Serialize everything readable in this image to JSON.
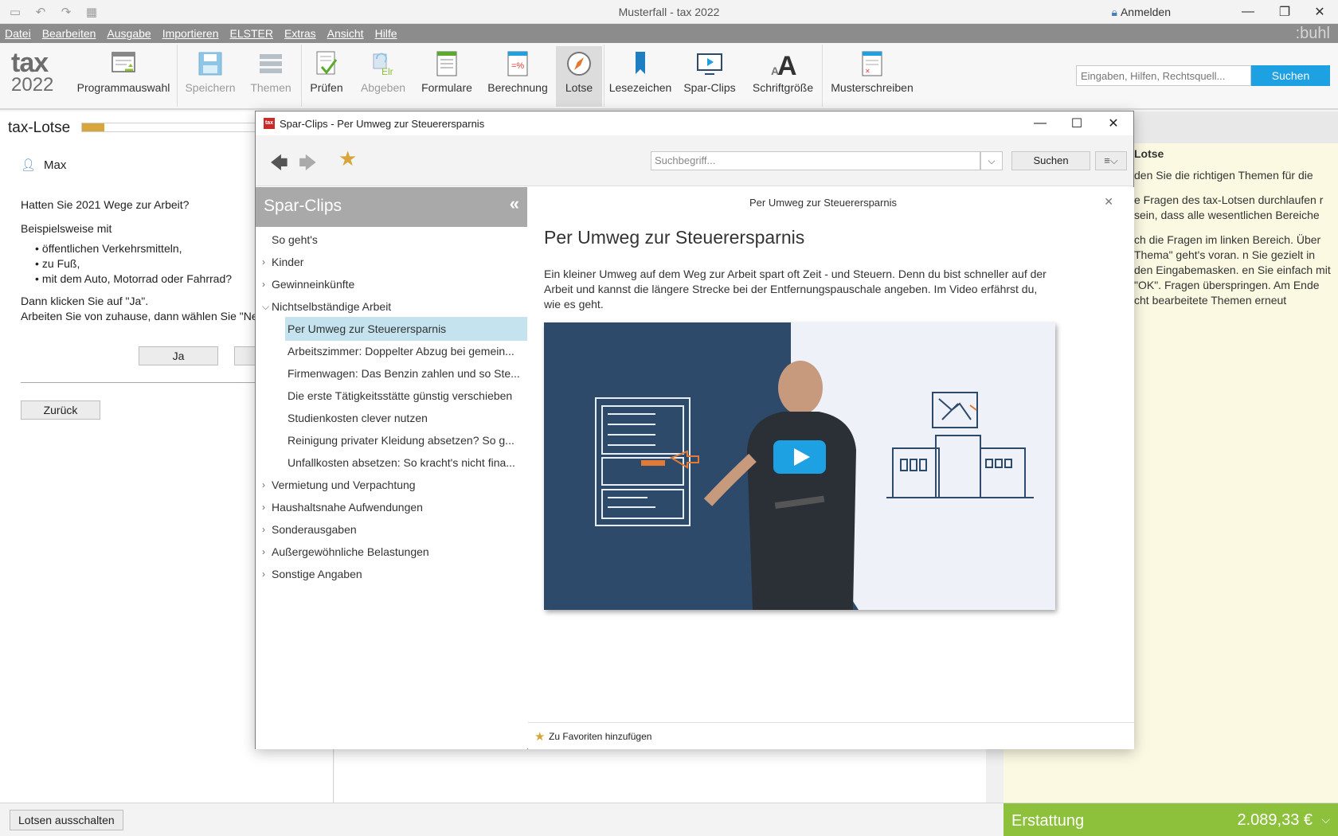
{
  "window": {
    "title": "Musterfall - tax 2022",
    "login_label": "Anmelden"
  },
  "menu": {
    "items": [
      "Datei",
      "Bearbeiten",
      "Ausgabe",
      "Importieren",
      "ELSTER",
      "Extras",
      "Ansicht",
      "Hilfe"
    ],
    "brand": ":buhl"
  },
  "logo": {
    "line1": "tax",
    "line2": "2022"
  },
  "ribbon": {
    "buttons": [
      {
        "label": "Programmauswahl",
        "icon": "program-select-icon",
        "state": "normal"
      },
      {
        "label": "Speichern",
        "icon": "save-icon",
        "state": "disabled"
      },
      {
        "label": "Themen",
        "icon": "topics-icon",
        "state": "disabled"
      },
      {
        "label": "Prüfen",
        "icon": "check-icon",
        "state": "normal"
      },
      {
        "label": "Abgeben",
        "icon": "submit-icon",
        "state": "disabled"
      },
      {
        "label": "Formulare",
        "icon": "forms-icon",
        "state": "normal"
      },
      {
        "label": "Berechnung",
        "icon": "calculation-icon",
        "state": "normal"
      },
      {
        "label": "Lotse",
        "icon": "compass-icon",
        "state": "active"
      },
      {
        "label": "Lesezeichen",
        "icon": "bookmark-icon",
        "state": "normal"
      },
      {
        "label": "Spar-Clips",
        "icon": "video-clip-icon",
        "state": "normal"
      },
      {
        "label": "Schriftgröße",
        "icon": "font-size-icon",
        "state": "normal"
      },
      {
        "label": "Musterschreiben",
        "icon": "sample-letter-icon",
        "state": "normal"
      }
    ],
    "search_placeholder": "Eingaben, Hilfen, Rechtsquell...",
    "search_button": "Suchen"
  },
  "lotse": {
    "title": "tax-Lotse",
    "progress": 0.13,
    "user": "Max",
    "question": "Hatten Sie 2021 Wege zur Arbeit?",
    "example_intro": "Beispielsweise mit",
    "examples": [
      "öffentlichen Verkehrsmitteln,",
      "zu Fuß,",
      "mit dem Auto, Motorrad oder Fahrrad?"
    ],
    "instruction1": "Dann klicken Sie auf \"Ja\".",
    "instruction2": "Arbeiten Sie von zuhause, dann wählen Sie \"Nein\".",
    "yes_label": "Ja",
    "back_label": "Zurück",
    "off_label": "Lotsen ausschalten"
  },
  "help_panel": {
    "title": "Lotse",
    "paragraphs": [
      "den Sie die richtigen Themen für die",
      "e Fragen des tax-Lotsen durchlaufen r sein, dass alle wesentlichen Bereiche",
      "ch die Fragen im linken Bereich. Über Thema\" geht's voran. n Sie gezielt in den Eingabemasken. en Sie einfach mit \"OK\". Fragen überspringen. Am Ende cht bearbeitete Themen erneut"
    ]
  },
  "refund": {
    "label": "Erstattung",
    "amount": "2.089,33 €"
  },
  "dialog": {
    "title": "Spar-Clips - Per Umweg zur Steuerersparnis",
    "search_placeholder": "Suchbegriff...",
    "search_button": "Suchen",
    "sidebar_title": "Spar-Clips",
    "tree": [
      {
        "label": "So geht's",
        "expandable": false,
        "expanded": false
      },
      {
        "label": "Kinder",
        "expandable": true,
        "expanded": false
      },
      {
        "label": "Gewinneinkünfte",
        "expandable": true,
        "expanded": false
      },
      {
        "label": "Nichtselbständige Arbeit",
        "expandable": true,
        "expanded": true
      }
    ],
    "children": [
      {
        "label": "Per Umweg zur Steuerersparnis",
        "selected": true
      },
      {
        "label": "Arbeitszimmer: Doppelter Abzug bei gemein...",
        "selected": false
      },
      {
        "label": "Firmenwagen: Das Benzin zahlen und so Ste...",
        "selected": false
      },
      {
        "label": "Die erste Tätigkeitsstätte günstig verschieben",
        "selected": false
      },
      {
        "label": "Studienkosten clever nutzen",
        "selected": false
      },
      {
        "label": "Reinigung privater Kleidung absetzen? So g...",
        "selected": false
      },
      {
        "label": "Unfallkosten absetzen: So kracht's nicht fina...",
        "selected": false
      }
    ],
    "tree_after": [
      {
        "label": "Vermietung und Verpachtung"
      },
      {
        "label": "Haushaltsnahe Aufwendungen"
      },
      {
        "label": "Sonderausgaben"
      },
      {
        "label": "Außergewöhnliche Belastungen"
      },
      {
        "label": "Sonstige Angaben"
      }
    ],
    "content_header": "Per Umweg zur Steuerersparnis",
    "content_title": "Per Umweg zur Steuerersparnis",
    "content_body": "Ein kleiner Umweg auf dem Weg zur Arbeit spart oft Zeit - und Steuern. Denn du bist schneller auf der Arbeit und kannst die längere Strecke bei der Entfernungspauschale angeben. Im Video erfährst du, wie es geht.",
    "favorite_label": "Zu Favoriten hinzufügen"
  },
  "colors": {
    "accent_blue": "#1da1e2",
    "refund_green": "#8dc03b",
    "progress_gold": "#d7a53a",
    "selected_row": "#c4e3ee",
    "video_dark": "#2e4a6b"
  }
}
